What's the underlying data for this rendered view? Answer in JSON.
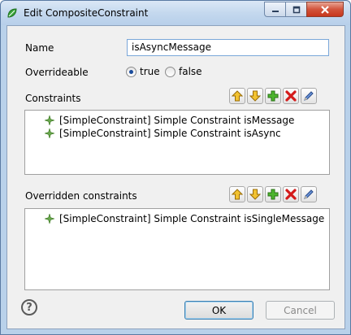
{
  "window": {
    "title": "Edit CompositeConstraint"
  },
  "form": {
    "name_label": "Name",
    "name_value": "isAsyncMessage",
    "overrideable_label": "Overrideable",
    "radio_true": "true",
    "radio_false": "false",
    "selected": "true"
  },
  "constraints": {
    "label": "Constraints",
    "items": [
      "[SimpleConstraint] Simple Constraint isMessage",
      "[SimpleConstraint] Simple Constraint isAsync"
    ]
  },
  "overridden": {
    "label": "Overridden constraints",
    "items": [
      "[SimpleConstraint] Simple Constraint isSingleMessage"
    ]
  },
  "buttons": {
    "help": "?",
    "ok": "OK",
    "cancel": "Cancel"
  },
  "icons": {
    "toolbar": [
      "move-up-icon",
      "move-down-icon",
      "add-icon",
      "remove-icon",
      "edit-icon"
    ],
    "item": "constraint-star-icon"
  },
  "colors": {
    "add_green": "#3a9d23",
    "remove_red": "#d01818",
    "arrow_yellow": "#e8b21c",
    "edit_blue": "#3b6fc4"
  }
}
